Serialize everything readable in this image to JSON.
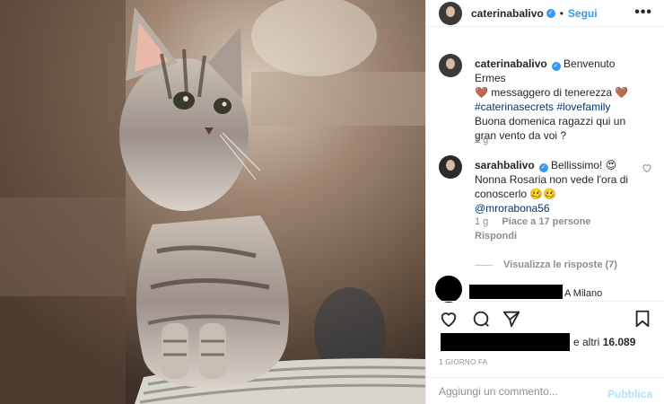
{
  "post": {
    "author": "caterinabalivo",
    "follow_label": "Segui",
    "separator": "•",
    "more_label": "•••"
  },
  "caption": {
    "author": "caterinabalivo",
    "line1_before": "Benvenuto Ermes",
    "line1_emoji": "🤎",
    "line2": "messaggero di tenerezza",
    "line2_emoji": "🤎",
    "hashtags": "#caterinasecrets #lovefamily",
    "line3": "Buona domenica ragazzi qui un gran vento da voi ?",
    "age": "1 g"
  },
  "comment": {
    "author": "sarahbalivo",
    "text1": "Bellissimo!",
    "emoji1": "😍",
    "text2": "Nonna Rosaria non vede l'ora di conoscerlo",
    "emoji2": "🥴🥴",
    "mention": "@mrorabona56",
    "age": "1 g",
    "likes": "Piace a 17 persone",
    "reply": "Rispondi",
    "view_replies": "Visualizza le risposte (7)"
  },
  "redacted_comment": {
    "location": "A Milano"
  },
  "likes": {
    "prefix": "e altri",
    "count": "16.089"
  },
  "timestamp": "1 GIORNO FA",
  "comment_input": {
    "placeholder": "Aggiungi un commento...",
    "publish_label": "Pubblica"
  },
  "colors": {
    "link_blue": "#3897f0",
    "hashtag_navy": "#00376b",
    "publish_disabled": "#b2dffc"
  }
}
